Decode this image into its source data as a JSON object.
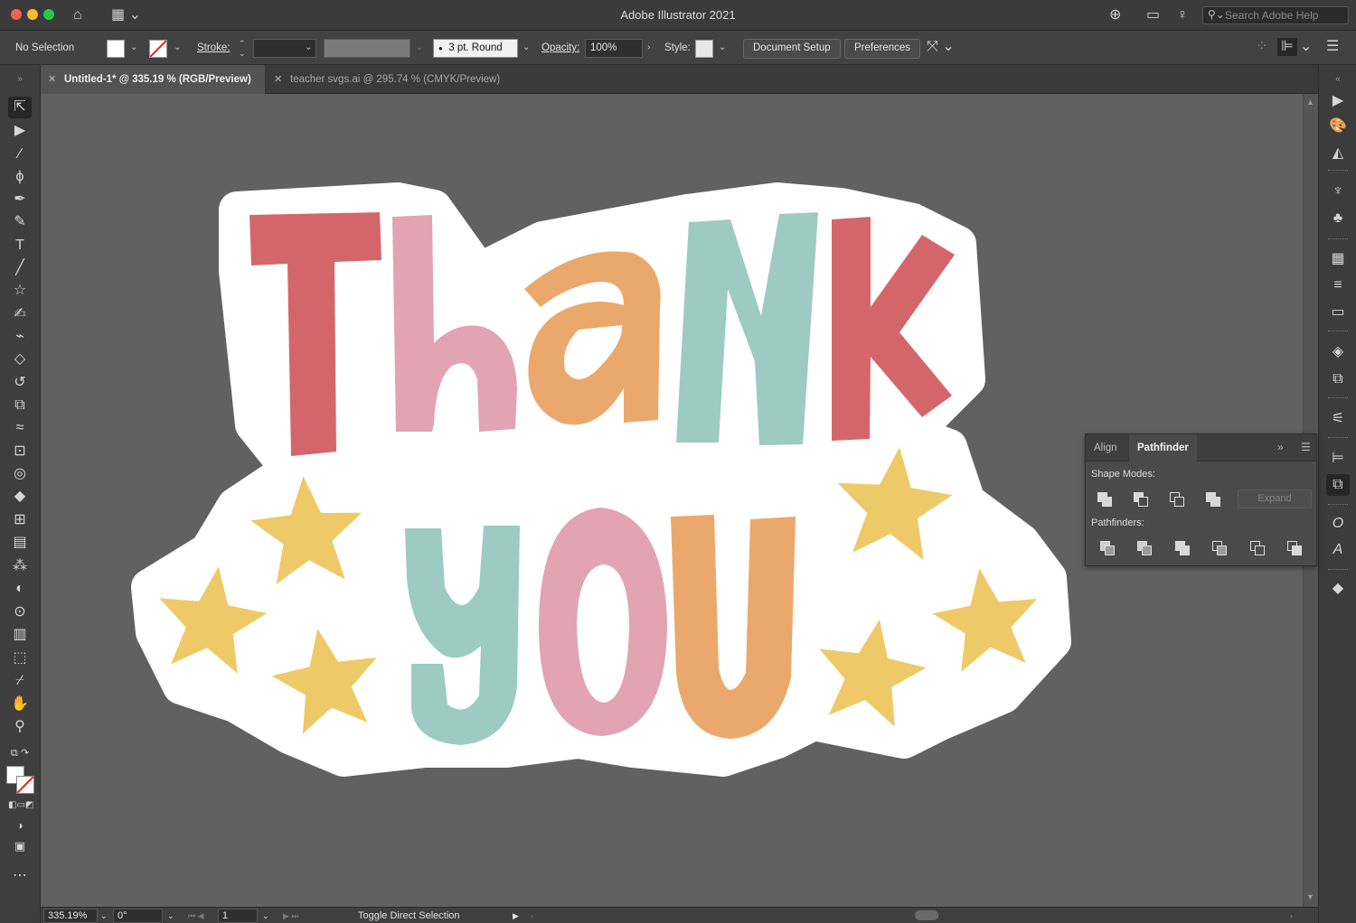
{
  "app": {
    "title": "Adobe Illustrator 2021"
  },
  "search": {
    "placeholder": "Search Adobe Help"
  },
  "control": {
    "selection": "No Selection",
    "stroke_label": "Stroke:",
    "brush_label": "3 pt. Round",
    "opacity_label": "Opacity:",
    "opacity_value": "100%",
    "style_label": "Style:",
    "doc_setup": "Document Setup",
    "preferences": "Preferences"
  },
  "tabs": [
    {
      "label": "Untitled-1* @ 335.19 % (RGB/Preview)"
    },
    {
      "label": "teacher svgs.ai @ 295.74 % (CMYK/Preview)"
    }
  ],
  "panel": {
    "tab_align": "Align",
    "tab_pathfinder": "Pathfinder",
    "shape_modes": "Shape Modes:",
    "expand": "Expand",
    "pathfinders": "Pathfinders:"
  },
  "status": {
    "zoom": "335.19%",
    "rotation": "0°",
    "artboard": "1",
    "tool": "Toggle Direct Selection"
  },
  "colors": {
    "red": "#d4666b",
    "pink": "#e2a3b3",
    "orange": "#eba86d",
    "teal": "#9dcbc1",
    "star": "#eec967",
    "sticker": "#ffffff"
  }
}
